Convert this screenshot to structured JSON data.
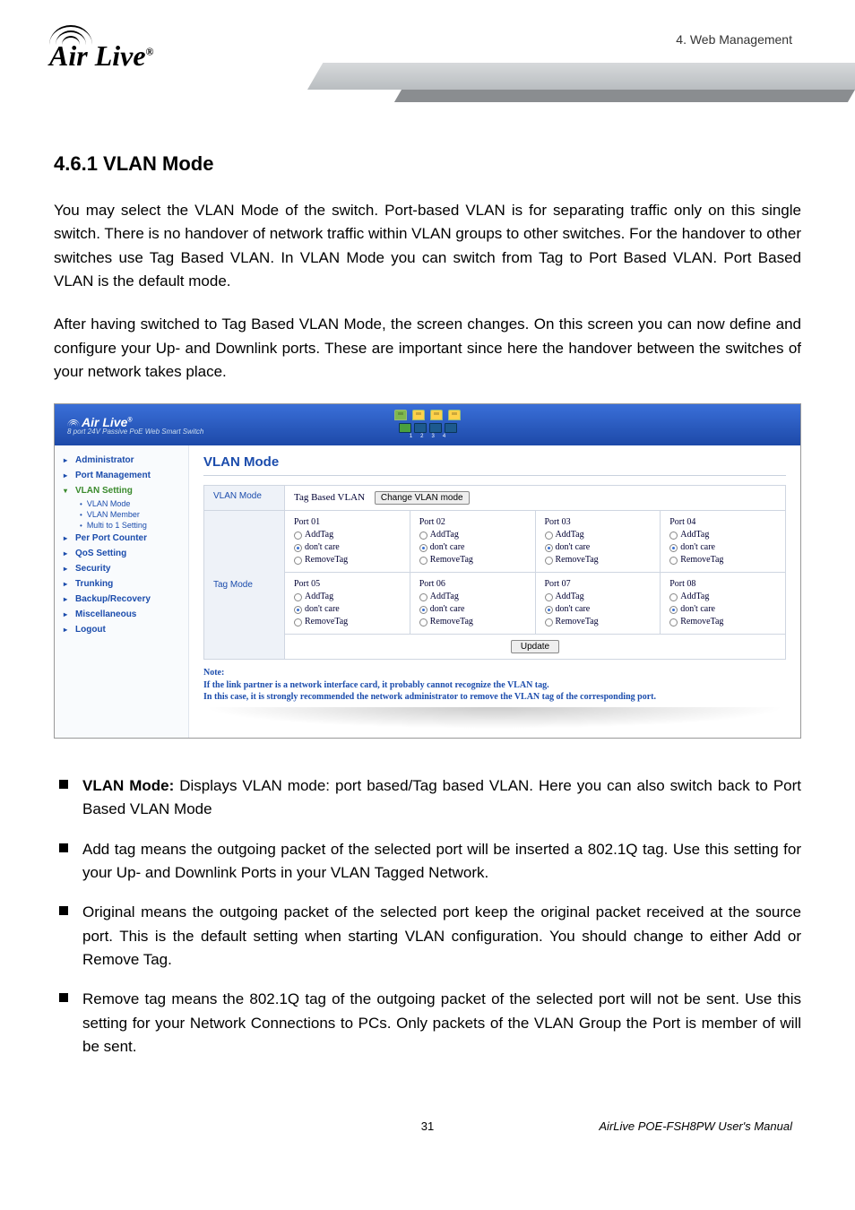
{
  "header": {
    "right_label": "4. Web Management",
    "logo_text": "Air Live",
    "logo_reg": "®"
  },
  "section": {
    "heading": "4.6.1 VLAN Mode",
    "p1": "You may select the VLAN Mode of the switch. Port-based VLAN is for separating traffic only on this single switch. There is no handover of network traffic within VLAN groups to other switches. For the handover to other switches use Tag Based VLAN. In VLAN Mode you can switch from Tag to Port Based VLAN. Port Based VLAN is the default mode.",
    "p2": "After having switched to Tag Based VLAN Mode, the screen changes. On this screen you can now define and configure your Up- and Downlink ports. These are important since here the handover between the switches of your network takes place."
  },
  "screenshot": {
    "product_line": "8 port 24V Passive PoE Web Smart Switch",
    "sidebar": {
      "administrator": "Administrator",
      "port_management": "Port Management",
      "vlan_setting": "VLAN Setting",
      "vlan_mode": "VLAN Mode",
      "vlan_member": "VLAN Member",
      "multi_to_1": "Multi to 1 Setting",
      "per_port_counter": "Per Port Counter",
      "qos_setting": "QoS Setting",
      "security": "Security",
      "trunking": "Trunking",
      "backup_recovery": "Backup/Recovery",
      "miscellaneous": "Miscellaneous",
      "logout": "Logout"
    },
    "main": {
      "title": "VLAN Mode",
      "vlan_mode_label": "VLAN Mode",
      "vlan_mode_value": "Tag Based VLAN",
      "change_btn": "Change VLAN mode",
      "tag_mode_label": "Tag Mode",
      "ports_a": [
        {
          "name": "Port 01"
        },
        {
          "name": "Port 02"
        },
        {
          "name": "Port 03"
        },
        {
          "name": "Port 04"
        }
      ],
      "ports_b": [
        {
          "name": "Port 05"
        },
        {
          "name": "Port 06"
        },
        {
          "name": "Port 07"
        },
        {
          "name": "Port 08"
        }
      ],
      "opt_add": "AddTag",
      "opt_dont": "don't care",
      "opt_remove": "RemoveTag",
      "update_btn": "Update",
      "note_label": "Note:",
      "note_line1": "If the link partner is a network interface card, it probably cannot recognize the VLAN tag.",
      "note_line2": "In this case, it is strongly recommended the network administrator to remove the VLAN tag of the corresponding port."
    },
    "port_numbers": [
      "1",
      "2",
      "3",
      "4"
    ]
  },
  "bullets": {
    "b1_lead": "VLAN Mode:",
    "b1_rest": " Displays VLAN mode: port based/Tag based VLAN. Here you can also switch back to Port Based VLAN Mode",
    "b2": "Add tag means the outgoing packet of the selected port will be inserted a 802.1Q tag. Use this setting for your Up- and Downlink Ports in your VLAN Tagged Network.",
    "b3": "Original means the outgoing packet of the selected port keep the original packet received at the source port. This is the default setting when starting VLAN configuration. You should change to either Add or Remove Tag.",
    "b4": "Remove tag means the 802.1Q tag of the outgoing packet of the selected port will not be sent. Use this setting for your Network Connections to PCs. Only packets of the VLAN Group the Port is member of will be sent."
  },
  "footer": {
    "page": "31",
    "manual": "AirLive POE-FSH8PW User's Manual"
  }
}
